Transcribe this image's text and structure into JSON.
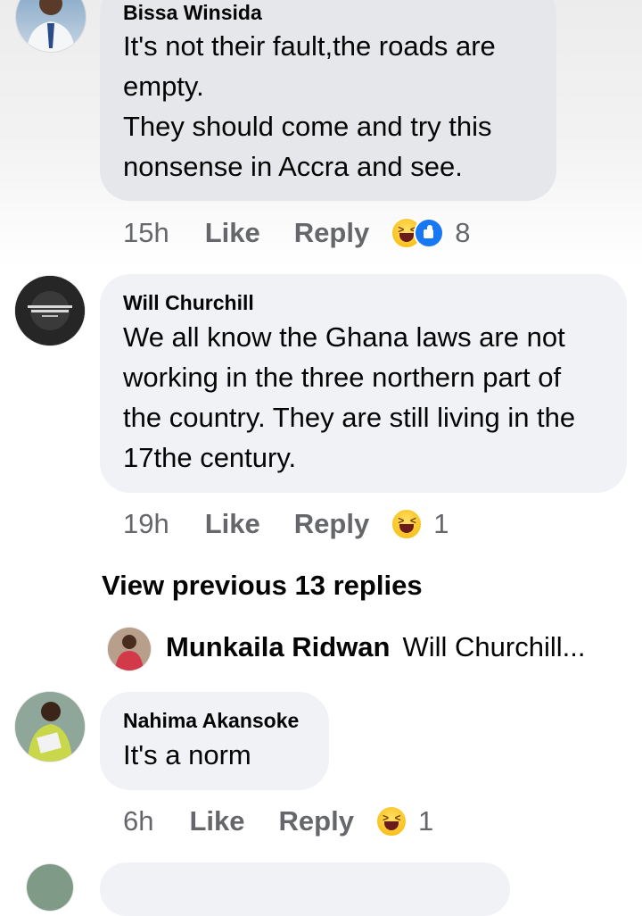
{
  "comments": [
    {
      "author": "Bissa Winsida",
      "text": "It's not their fault,the roads are empty.\nThey should come and try this nonsense in Accra and see.",
      "time": "15h",
      "like_label": "Like",
      "reply_label": "Reply",
      "reaction_icons": [
        "haha-emoji-icon",
        "like-reaction-icon"
      ],
      "reaction_count": "8"
    },
    {
      "author": "Will Churchill",
      "text": "We all know the Ghana laws are not working in the three northern part of the country. They are still living in the 17the century.",
      "time": "19h",
      "like_label": "Like",
      "reply_label": "Reply",
      "reaction_icons": [
        "haha-emoji-icon"
      ],
      "reaction_count": "1"
    },
    {
      "author": "Nahima Akansoke",
      "text": "It's a norm",
      "time": "6h",
      "like_label": "Like",
      "reply_label": "Reply",
      "reaction_icons": [
        "haha-emoji-icon"
      ],
      "reaction_count": "1"
    }
  ],
  "view_previous_label": "View previous 13 replies",
  "reply_preview": {
    "author": "Munkaila Ridwan",
    "text": "Will Churchill..."
  },
  "colors": {
    "bubble": "#f0f2f5",
    "meta_text": "#65676b",
    "like_blue": "#1877f2",
    "haha_yellow": "#f7b500"
  }
}
